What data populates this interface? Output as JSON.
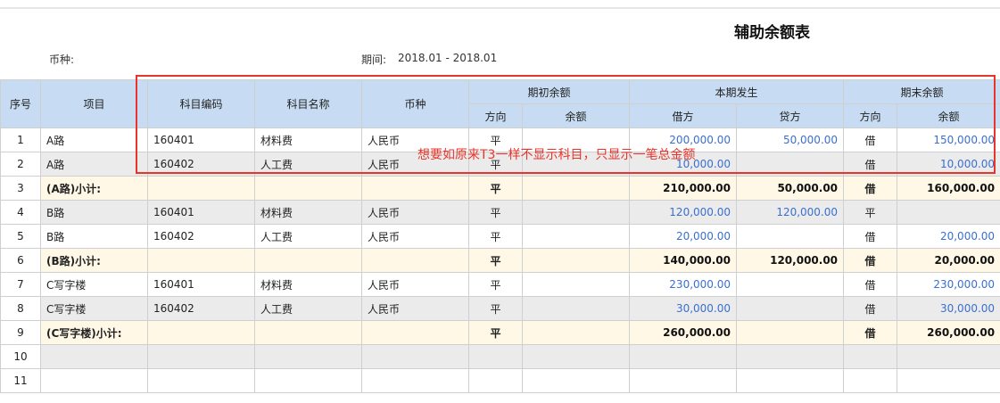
{
  "header": {
    "title": "辅助余额表",
    "currency_label": "币种:",
    "period_label": "期间:",
    "period_value": "2018.01 - 2018.01"
  },
  "table": {
    "headers": {
      "seq": "序号",
      "item": "项目",
      "code": "科目编码",
      "name": "科目名称",
      "currency": "币种",
      "opening": "期初余额",
      "period": "本期发生",
      "closing": "期末余额",
      "direction": "方向",
      "balance": "余额",
      "debit": "借方",
      "credit": "贷方"
    },
    "rows": [
      {
        "seq": "1",
        "item": "A路",
        "code": "160401",
        "name": "材料费",
        "currency": "人民币",
        "open_dir": "平",
        "open_bal": "",
        "debit": "200,000.00",
        "credit": "50,000.00",
        "close_dir": "借",
        "close_bal": "150,000.00"
      },
      {
        "seq": "2",
        "item": "A路",
        "code": "160402",
        "name": "人工费",
        "currency": "人民币",
        "open_dir": "平",
        "open_bal": "",
        "debit": "10,000.00",
        "credit": "",
        "close_dir": "借",
        "close_bal": "10,000.00"
      },
      {
        "seq": "3",
        "item": "(A路)小计:",
        "code": "",
        "name": "",
        "currency": "",
        "open_dir": "平",
        "open_bal": "",
        "debit": "210,000.00",
        "credit": "50,000.00",
        "close_dir": "借",
        "close_bal": "160,000.00"
      },
      {
        "seq": "4",
        "item": "B路",
        "code": "160401",
        "name": "材料费",
        "currency": "人民币",
        "open_dir": "平",
        "open_bal": "",
        "debit": "120,000.00",
        "credit": "120,000.00",
        "close_dir": "平",
        "close_bal": ""
      },
      {
        "seq": "5",
        "item": "B路",
        "code": "160402",
        "name": "人工费",
        "currency": "人民币",
        "open_dir": "平",
        "open_bal": "",
        "debit": "20,000.00",
        "credit": "",
        "close_dir": "借",
        "close_bal": "20,000.00"
      },
      {
        "seq": "6",
        "item": "(B路)小计:",
        "code": "",
        "name": "",
        "currency": "",
        "open_dir": "平",
        "open_bal": "",
        "debit": "140,000.00",
        "credit": "120,000.00",
        "close_dir": "借",
        "close_bal": "20,000.00"
      },
      {
        "seq": "7",
        "item": "C写字楼",
        "code": "160401",
        "name": "材料费",
        "currency": "人民币",
        "open_dir": "平",
        "open_bal": "",
        "debit": "230,000.00",
        "credit": "",
        "close_dir": "借",
        "close_bal": "230,000.00"
      },
      {
        "seq": "8",
        "item": "C写字楼",
        "code": "160402",
        "name": "人工费",
        "currency": "人民币",
        "open_dir": "平",
        "open_bal": "",
        "debit": "30,000.00",
        "credit": "",
        "close_dir": "借",
        "close_bal": "30,000.00"
      },
      {
        "seq": "9",
        "item": "(C写字楼)小计:",
        "code": "",
        "name": "",
        "currency": "",
        "open_dir": "平",
        "open_bal": "",
        "debit": "260,000.00",
        "credit": "",
        "close_dir": "借",
        "close_bal": "260,000.00"
      },
      {
        "seq": "10",
        "item": "",
        "code": "",
        "name": "",
        "currency": "",
        "open_dir": "",
        "open_bal": "",
        "debit": "",
        "credit": "",
        "close_dir": "",
        "close_bal": ""
      },
      {
        "seq": "11",
        "item": "",
        "code": "",
        "name": "",
        "currency": "",
        "open_dir": "",
        "open_bal": "",
        "debit": "",
        "credit": "",
        "close_dir": "",
        "close_bal": ""
      }
    ]
  },
  "annotation": {
    "text": "想要如原来T3一样不显示科目，只显示一笔总金额",
    "color": "#e8352b"
  },
  "colors": {
    "header_bg": "#c7dcf2",
    "subtotal_bg": "#fff8e6",
    "stripe_bg": "#ebebeb",
    "amount_blue": "#3a6fd0"
  }
}
